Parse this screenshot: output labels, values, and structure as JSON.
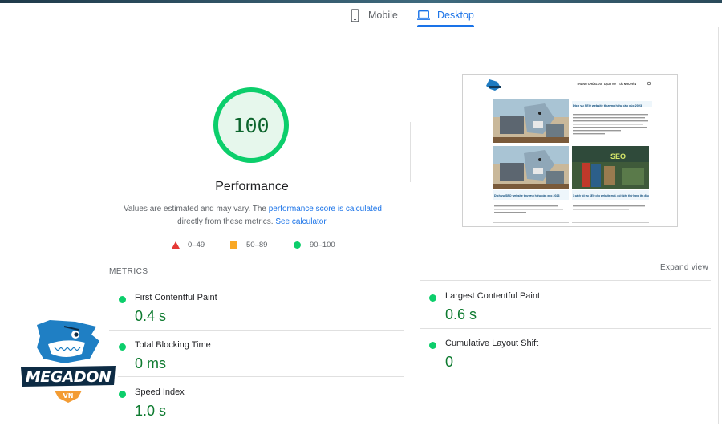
{
  "tabs": {
    "mobile": "Mobile",
    "desktop": "Desktop",
    "active": "desktop"
  },
  "performance": {
    "score": "100",
    "title": "Performance",
    "desc_prefix": "Values are estimated and may vary. The ",
    "link1": "performance score is calculated",
    "desc_mid": "directly from these metrics. ",
    "link2": "See calculator.",
    "legend": {
      "fail": "0–49",
      "average": "50–89",
      "pass": "90–100"
    }
  },
  "metrics": {
    "section_label": "METRICS",
    "expand": "Expand view",
    "items": [
      {
        "name": "First Contentful Paint",
        "value": "0.4 s"
      },
      {
        "name": "Largest Contentful Paint",
        "value": "0.6 s"
      },
      {
        "name": "Total Blocking Time",
        "value": "0 ms"
      },
      {
        "name": "Cumulative Layout Shift",
        "value": "0"
      },
      {
        "name": "Speed Index",
        "value": "1.0 s"
      }
    ]
  },
  "preview": {
    "nav": [
      "TRANG CHỦ",
      "BLOG",
      "DỊCH VỤ",
      "TÀI NGUYÊN"
    ],
    "post1_title": "Dịch vụ SEO website thương hiệu cần xúc 2023",
    "post2_title": "Dịch vụ SEO website thương hiệu cần xúc 2023",
    "post3_title": "3 cách tối ưu SEO cho website mới, cải thiện thứ hạng lên đầu",
    "seo_badge": "SEO"
  },
  "logo": {
    "text": "MEGADON",
    "sub": "VN"
  },
  "colors": {
    "pass": "#0cce6b",
    "pass_text": "#0d7a2f",
    "average": "#f9a825",
    "fail": "#e53935",
    "link": "#1a73e8"
  }
}
